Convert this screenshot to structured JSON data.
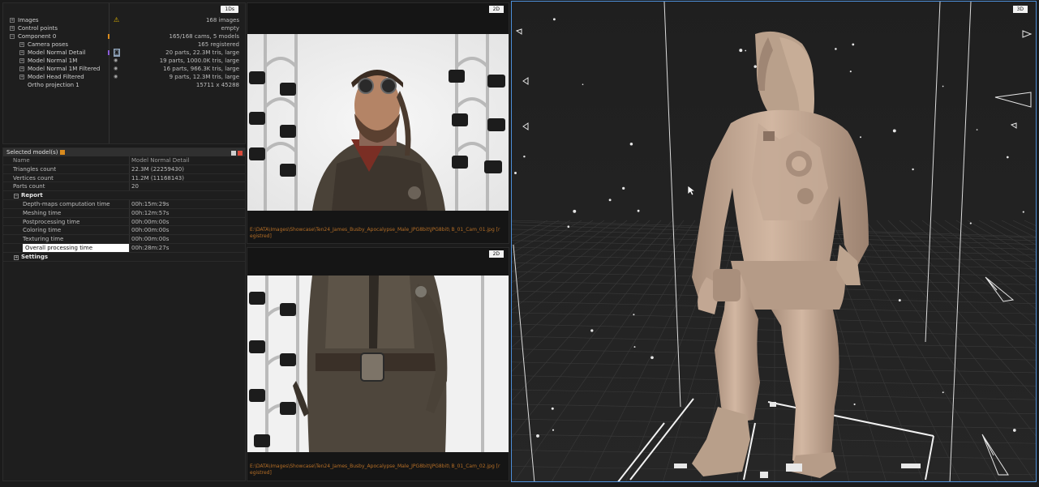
{
  "tree": {
    "top_button": "1Ds",
    "rows": [
      {
        "label": "Images",
        "value": "168 images",
        "indent": 0,
        "icon": "warning-icon"
      },
      {
        "label": "Control points",
        "value": "empty",
        "indent": 0
      },
      {
        "label": "Component 0",
        "value": "165/168 cams, 5 models",
        "indent": 0,
        "mark": "orange"
      },
      {
        "label": "Camera poses",
        "value": "165 registered",
        "indent": 1
      },
      {
        "label": "Model Normal Detail",
        "value": "20 parts, 22.3M tris, large",
        "indent": 1,
        "mark": "purple",
        "icon": "selected-model-icon"
      },
      {
        "label": "Model Normal 1M",
        "value": "19 parts, 1000.0K tris, large",
        "indent": 1,
        "icon": "eye-icon"
      },
      {
        "label": "Model Normal 1M Filtered",
        "value": "16 parts, 966.3K tris, large",
        "indent": 1,
        "icon": "eye-icon"
      },
      {
        "label": "Model Head Filtered",
        "value": "9 parts, 12.3M tris, large",
        "indent": 1,
        "icon": "eye-icon"
      },
      {
        "label": "Ortho projection 1",
        "value": "15711 x 45288",
        "indent": 1
      }
    ]
  },
  "props": {
    "title": "Selected model(s)",
    "header": {
      "name": "Name",
      "value": "Model Normal Detail"
    },
    "rows": [
      {
        "k": "Triangles count",
        "v": "22.3M (22259430)"
      },
      {
        "k": "Vertices count",
        "v": "11.2M (11168143)"
      },
      {
        "k": "Parts count",
        "v": "20"
      }
    ],
    "report_label": "Report",
    "report_rows": [
      {
        "k": "Depth-maps computation time",
        "v": "00h:15m:29s"
      },
      {
        "k": "Meshing time",
        "v": "00h:12m:57s"
      },
      {
        "k": "Postprocessing time",
        "v": "00h:00m:00s"
      },
      {
        "k": "Coloring time",
        "v": "00h:00m:00s"
      },
      {
        "k": "Texturing time",
        "v": "00h:00m:00s"
      },
      {
        "k": "Overall processing time",
        "v": "00h:28m:27s"
      }
    ],
    "settings_label": "Settings"
  },
  "view2d_top": {
    "tag": "2D",
    "caption": "E:\\DATA\\Images\\Showcase\\Ten24_James_Busby_Apocalypse_Male_JPG8bit\\JPG8bit\\ B_01_Cam_01.jpg [registred]"
  },
  "view2d_bottom": {
    "tag": "2D",
    "caption": "E:\\DATA\\Images\\Showcase\\Ten24_James_Busby_Apocalypse_Male_JPG8bit\\JPG8bit\\ B_01_Cam_02.jpg [registred]"
  },
  "view3d": {
    "tag": "3D"
  },
  "colors": {
    "accent_border": "#4d8fd9",
    "caption": "#b56e26",
    "model": "#c9ad98"
  }
}
